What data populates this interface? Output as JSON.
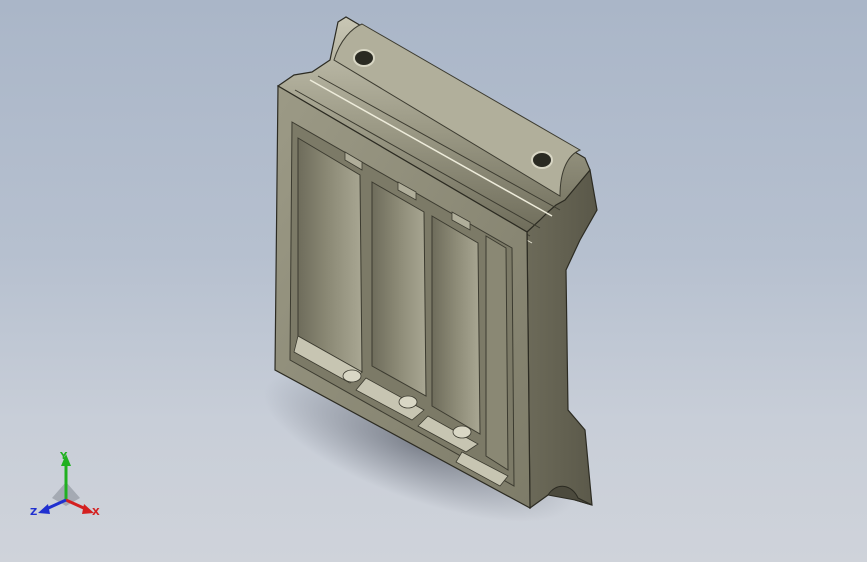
{
  "viewport": {
    "background_top": "#aab6c8",
    "background_bottom": "#cfd3da",
    "model_color": "#8e8c78"
  },
  "triad": {
    "x_label": "X",
    "y_label": "Y",
    "z_label": "Z",
    "x_color": "#d42020",
    "y_color": "#20b020",
    "z_color": "#2030d0"
  }
}
